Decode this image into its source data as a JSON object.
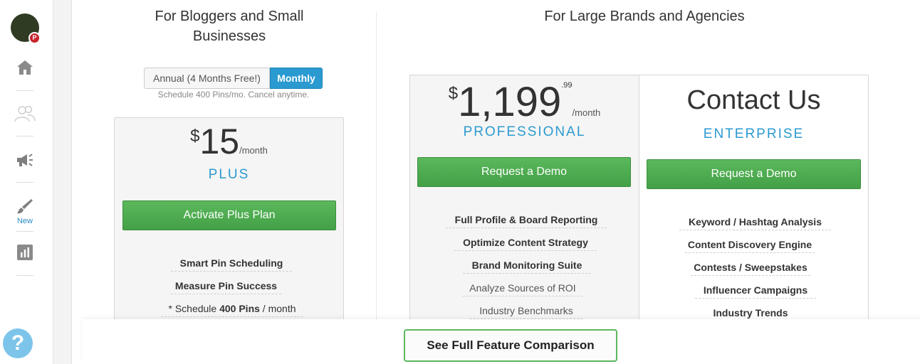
{
  "sidebar": {
    "new_label": "New",
    "help_label": "?"
  },
  "headings": {
    "small": "For Bloggers and Small Businesses",
    "large": "For Large Brands and Agencies"
  },
  "billing_toggle": {
    "annual_label": "Annual (4 Months Free!)",
    "monthly_label": "Monthly",
    "selected": "Monthly",
    "subtext": "Schedule 400 Pins/mo. Cancel anytime."
  },
  "plans": {
    "plus": {
      "currency": "$",
      "amount": "15",
      "period": "/month",
      "tier": "PLUS",
      "button": "Activate Plus Plan",
      "features": [
        {
          "text": "Smart Pin Scheduling"
        },
        {
          "text": "Measure Pin Success"
        }
      ],
      "feature3": {
        "pre": "* Schedule ",
        "bold": "400 Pins",
        "post": " / month"
      }
    },
    "professional": {
      "currency": "$",
      "amount": "1,199",
      "cents": ".99",
      "period": "/month",
      "tier": "PROFESSIONAL",
      "button": "Request a Demo",
      "features": [
        {
          "text": "Full Profile & Board Reporting"
        },
        {
          "text": "Optimize Content Strategy"
        },
        {
          "text": "Brand Monitoring Suite"
        },
        {
          "text": "Analyze Sources of ROI"
        },
        {
          "text": "Industry Benchmarks"
        }
      ]
    },
    "enterprise": {
      "headline": "Contact Us",
      "tier": "ENTERPRISE",
      "button": "Request a Demo",
      "features": [
        {
          "text": "Keyword / Hashtag Analysis"
        },
        {
          "text": "Content Discovery Engine"
        },
        {
          "text": "Contests / Sweepstakes"
        },
        {
          "text": "Influencer Campaigns"
        },
        {
          "text": "Industry Trends"
        }
      ]
    }
  },
  "compare_button": "See Full Feature Comparison",
  "colors": {
    "accent_blue": "#2a9ad0",
    "button_green": "#4cae4c"
  }
}
